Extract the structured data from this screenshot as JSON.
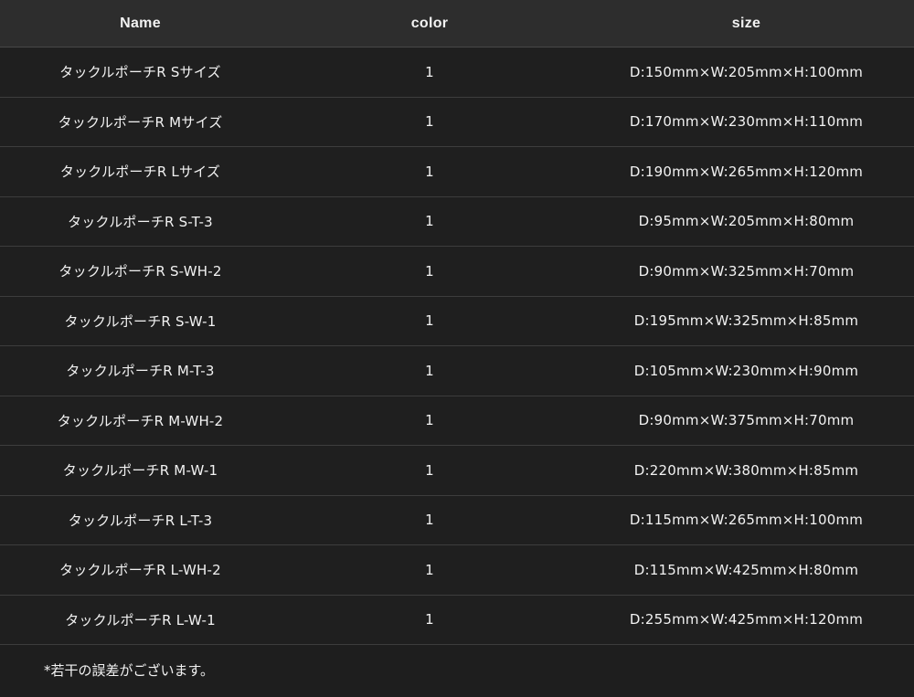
{
  "table": {
    "headers": {
      "name": "Name",
      "color": "color",
      "size": "size"
    },
    "rows": [
      {
        "name": "タックルポーチR Sサイズ",
        "color": "1",
        "size": "D:150mm×W:205mm×H:100mm"
      },
      {
        "name": "タックルポーチR Mサイズ",
        "color": "1",
        "size": "D:170mm×W:230mm×H:110mm"
      },
      {
        "name": "タックルポーチR Lサイズ",
        "color": "1",
        "size": "D:190mm×W:265mm×H:120mm"
      },
      {
        "name": "タックルポーチR S-T-3",
        "color": "1",
        "size": "D:95mm×W:205mm×H:80mm"
      },
      {
        "name": "タックルポーチR S-WH-2",
        "color": "1",
        "size": "D:90mm×W:325mm×H:70mm"
      },
      {
        "name": "タックルポーチR S-W-1",
        "color": "1",
        "size": "D:195mm×W:325mm×H:85mm"
      },
      {
        "name": "タックルポーチR M-T-3",
        "color": "1",
        "size": "D:105mm×W:230mm×H:90mm"
      },
      {
        "name": "タックルポーチR M-WH-2",
        "color": "1",
        "size": "D:90mm×W:375mm×H:70mm"
      },
      {
        "name": "タックルポーチR M-W-1",
        "color": "1",
        "size": "D:220mm×W:380mm×H:85mm"
      },
      {
        "name": "タックルポーチR L-T-3",
        "color": "1",
        "size": "D:115mm×W:265mm×H:100mm"
      },
      {
        "name": "タックルポーチR L-WH-2",
        "color": "1",
        "size": "D:115mm×W:425mm×H:80mm"
      },
      {
        "name": "タックルポーチR L-W-1",
        "color": "1",
        "size": "D:255mm×W:425mm×H:120mm"
      }
    ]
  },
  "note": "*若干の誤差がございます。",
  "colors": {
    "background": "#1e1e1e",
    "header_background": "#2d2d2d",
    "row_border": "#3d3d3d",
    "text": "#f2f2f2"
  }
}
